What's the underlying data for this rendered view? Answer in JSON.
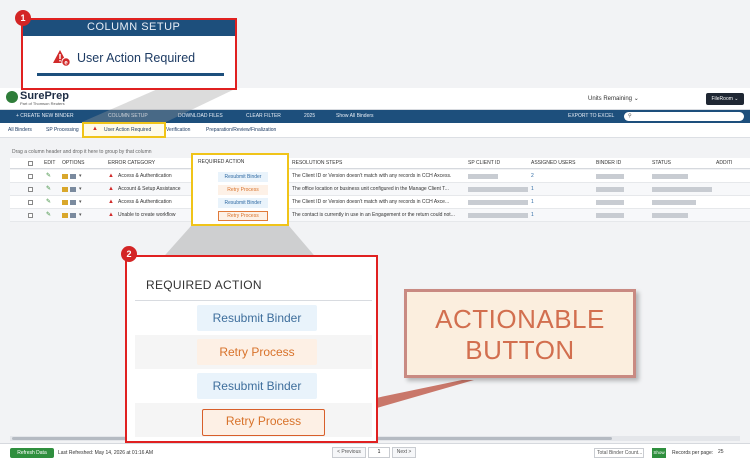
{
  "callout1": {
    "badge": "1",
    "top_band_text": "COLUMN SETUP",
    "label": "User Action Required",
    "icon": "warning-icon"
  },
  "app": {
    "logo": {
      "name": "SurePrep",
      "tagline": "Part of Thomson Reuters"
    },
    "units_remaining": "Units Remaining",
    "user_button": "FileRoom",
    "toolbar": {
      "create_new_binder": "+ CREATE NEW BINDER",
      "column_setup": "COLUMN SETUP",
      "download_files": "DOWNLOAD FILES",
      "clear_filter": "CLEAR FILTER",
      "year": "2025",
      "show_all_binders": "Show All Binders",
      "export_to_excel": "EXPORT TO EXCEL"
    },
    "tabs": [
      {
        "label": "All Binders"
      },
      {
        "label": "SP Processing"
      },
      {
        "label": "User Action Required"
      },
      {
        "label": "Verification"
      },
      {
        "label": "Preparation/Review/Finalization"
      }
    ],
    "hint": "Drag a column header and drop it here to group by that column",
    "columns": {
      "edit": "EDIT",
      "options": "OPTIONS",
      "error_category": "ERROR CATEGORY",
      "required_action": "REQUIRED ACTION",
      "resolution_steps": "RESOLUTION STEPS",
      "sp_client_id": "SP CLIENT ID",
      "assigned_users": "ASSIGNED USERS",
      "binder_id": "BINDER ID",
      "status": "STATUS",
      "additional": "ADDITI"
    },
    "rows": [
      {
        "error_category": "Access & Authentication",
        "resolution": "The Client ID or Version doesn't match with any records in CCH Axcess.",
        "assigned": "2"
      },
      {
        "error_category": "Account & Setup Assistance",
        "resolution": "The office location or business unit configured in the Manage Client T...",
        "assigned": "1"
      },
      {
        "error_category": "Access & Authentication",
        "resolution": "The Client ID or Version doesn't match with any records in CCH Axce...",
        "assigned": "1"
      },
      {
        "error_category": "Unable to create workflow",
        "resolution": "The contact is currently in use in an Engagement or the return could not...",
        "assigned": "1"
      }
    ],
    "mini_panel": {
      "header": "REQUIRED ACTION",
      "actions": [
        "Resubmit Binder",
        "Retry Process",
        "Resubmit Binder",
        "Retry Process"
      ]
    },
    "footer": {
      "refresh": "Refresh Data",
      "last_refreshed": "Last Refreshed: May 14, 2026 at 01:16 AM",
      "previous": "< Previous",
      "page": "1",
      "next": "Next >",
      "binder_count": "Total Binder Count...",
      "show": "Show",
      "records_per_page": "Records per page:",
      "records_value": "25"
    }
  },
  "callout2": {
    "badge": "2",
    "header": "REQUIRED ACTION",
    "actions": [
      "Resubmit Binder",
      "Retry Process",
      "Resubmit Binder",
      "Retry Process"
    ]
  },
  "note": {
    "line1": "ACTIONABLE",
    "line2": "BUTTON"
  },
  "colors": {
    "accent_red": "#e02020",
    "nav_blue": "#1d4f7c",
    "resubmit_blue": "#3e6e9c",
    "retry_orange": "#d8722a",
    "highlight_yellow": "#f0c419",
    "note_bg": "#fbeede"
  }
}
